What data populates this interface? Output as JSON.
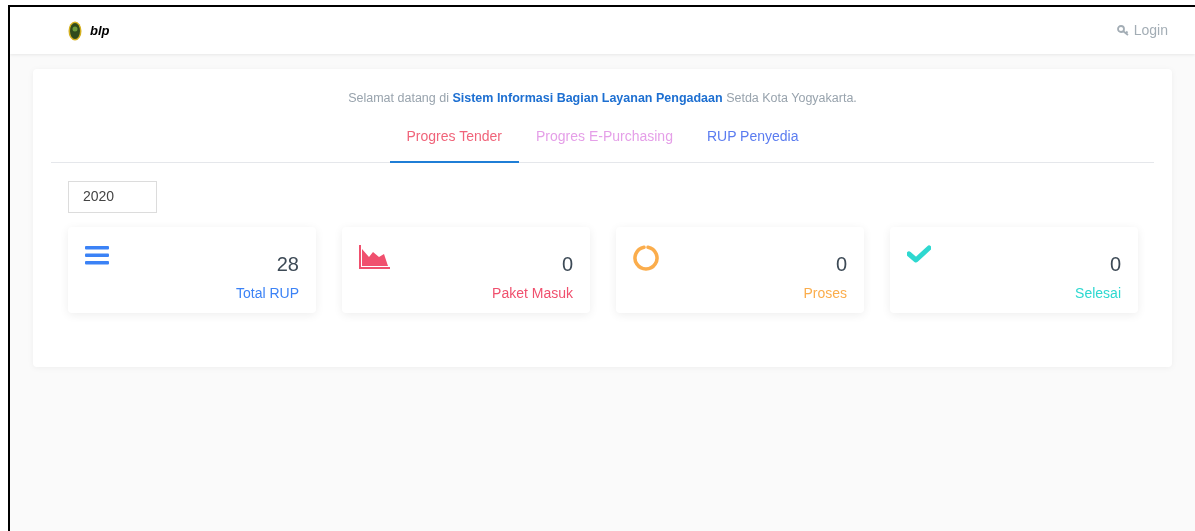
{
  "navbar": {
    "brand": "blp",
    "login": "Login"
  },
  "welcome": "Selamat datang di **Sistem Informasi Bagian Layanan Pengadaan** Setda Kota Yogyakarta.",
  "tabs": [
    {
      "label": "Progres Tender",
      "selected": true,
      "color": "#f0647a"
    },
    {
      "label": "Progres E-Purchasing",
      "selected": false,
      "color": "#e59fe8"
    },
    {
      "label": "RUP Penyedia",
      "selected": false,
      "color": "#5b7cf0"
    }
  ],
  "year": "2020",
  "cards": [
    {
      "kind": "list",
      "value": "28",
      "label": "Total RUP",
      "color": "#3b82f6"
    },
    {
      "kind": "area",
      "value": "0",
      "label": "Paket Masuk",
      "color": "#f0506e"
    },
    {
      "kind": "ring",
      "value": "0",
      "label": "Proses",
      "color": "#fbad4c"
    },
    {
      "kind": "check",
      "value": "0",
      "label": "Selesai",
      "color": "#2ed8d0"
    }
  ]
}
